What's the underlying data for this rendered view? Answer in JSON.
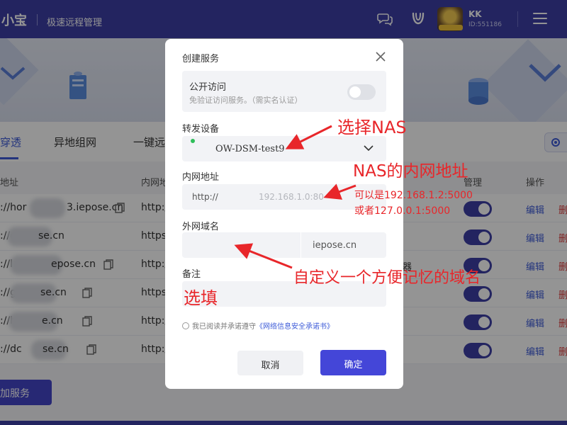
{
  "topbar": {
    "brand": "小宝",
    "subtitle": "极速远程管理",
    "user_name": "KK",
    "user_id": "ID:551186"
  },
  "tabs": [
    {
      "label": "穿透",
      "active": true
    },
    {
      "label": "异地组网",
      "active": false
    },
    {
      "label": "一键远",
      "active": false
    }
  ],
  "table": {
    "headers": {
      "address": "地址",
      "inner": "内网地",
      "manage": "管理",
      "ops": "操作"
    },
    "rows": [
      {
        "address": "://hor",
        "address_tail": "3.iepose.cn",
        "inner": "http:/",
        "extra": "",
        "enabled": true
      },
      {
        "address": "://c",
        "address_tail": "se.cn",
        "inner": "https",
        "extra": "",
        "enabled": true
      },
      {
        "address": "://l",
        "address_tail": "epose.cn",
        "inner": "http:/",
        "extra": "器",
        "enabled": true
      },
      {
        "address": "://g",
        "address_tail": "se.cn",
        "inner": "https",
        "extra": "",
        "enabled": true
      },
      {
        "address": "://h",
        "address_tail": "e.cn",
        "inner": "http:/",
        "extra": "",
        "enabled": true
      },
      {
        "address": "://dc",
        "address_tail": "se.cn",
        "inner": "http:/",
        "extra": "",
        "enabled": true
      }
    ],
    "edit_label": "编辑",
    "delete_label": "删"
  },
  "add_service_label": "加服务",
  "modal": {
    "title": "创建服务",
    "public_access": {
      "title": "公开访问",
      "subtitle": "免验证访问服务。（需实名认证）",
      "enabled": false
    },
    "device": {
      "label": "转发设备",
      "value": "OW-DSM-test9"
    },
    "inner_address": {
      "label": "内网地址",
      "scheme": "http://",
      "placeholder": "192.168.1.0:80"
    },
    "domain": {
      "label": "外网域名",
      "suffix": "iepose.cn"
    },
    "remark": {
      "label": "备注"
    },
    "agreement": {
      "prefix": "我已阅读并承诺遵守",
      "link": "《网络信息安全承诺书》"
    },
    "cancel_label": "取消",
    "confirm_label": "确定"
  },
  "annotations": {
    "choose_nas": "选择NAS",
    "nas_address": "NAS的内网地址",
    "example1": "可以是192.168.1.2:5000",
    "example2": "或者127.0.0.1:5000",
    "custom_domain": "自定义一个方便记忆的域名",
    "optional": "选填"
  },
  "colors": {
    "primary": "#3d3fa6",
    "accent": "#4446d8",
    "annotation": "#e8262a"
  }
}
